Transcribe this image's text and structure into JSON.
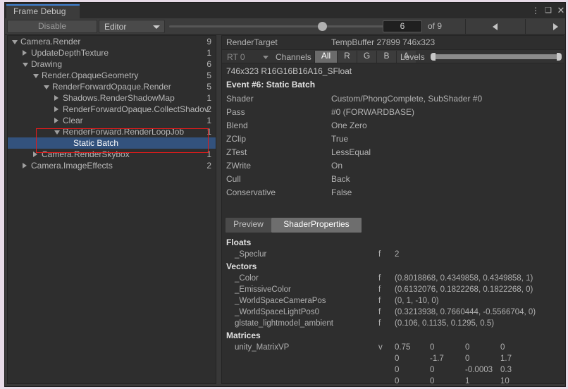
{
  "window": {
    "tab_label": "Frame Debug",
    "menu_icon": "⋮",
    "maximize_icon": "❑",
    "close_icon": "✕",
    "accent_color": "#3f80d0"
  },
  "toolbar": {
    "disable_label": "Disable",
    "target_dropdown": "Editor",
    "frame_value": "6",
    "frame_total_label": "of 9",
    "slider_percent": 63,
    "prev_icon": "triangle-left",
    "next_icon": "triangle-right"
  },
  "tree": {
    "rows": [
      {
        "label": "Camera.Render",
        "count": "9",
        "depth": 0,
        "twisty": "open",
        "selected": false
      },
      {
        "label": "UpdateDepthTexture",
        "count": "1",
        "depth": 1,
        "twisty": "closed",
        "selected": false
      },
      {
        "label": "Drawing",
        "count": "6",
        "depth": 1,
        "twisty": "open",
        "selected": false
      },
      {
        "label": "Render.OpaqueGeometry",
        "count": "5",
        "depth": 2,
        "twisty": "open",
        "selected": false
      },
      {
        "label": "RenderForwardOpaque.Render",
        "count": "5",
        "depth": 3,
        "twisty": "open",
        "selected": false
      },
      {
        "label": "Shadows.RenderShadowMap",
        "count": "1",
        "depth": 4,
        "twisty": "closed",
        "selected": false
      },
      {
        "label": "RenderForwardOpaque.CollectShadov",
        "count": "2",
        "depth": 4,
        "twisty": "closed",
        "selected": false
      },
      {
        "label": "Clear",
        "count": "1",
        "depth": 4,
        "twisty": "closed",
        "selected": false
      },
      {
        "label": "RenderForward.RenderLoopJob",
        "count": "1",
        "depth": 4,
        "twisty": "open",
        "selected": false
      },
      {
        "label": "Static Batch",
        "count": "",
        "depth": 5,
        "twisty": "none",
        "selected": true
      },
      {
        "label": "Camera.RenderSkybox",
        "count": "1",
        "depth": 2,
        "twisty": "closed",
        "selected": false
      },
      {
        "label": "Camera.ImageEffects",
        "count": "2",
        "depth": 1,
        "twisty": "closed",
        "selected": false
      }
    ],
    "highlight_color": "#e01b1b",
    "selection_color": "#33527d"
  },
  "detail": {
    "render_target_key": "RenderTarget",
    "render_target_value": "TempBuffer 27899 746x323",
    "rt_dropdown": "RT 0",
    "channels_label": "Channels",
    "channel_buttons": [
      "All",
      "R",
      "G",
      "B",
      "A"
    ],
    "channel_active": "All",
    "levels_label": "Levels",
    "format_line": "746x323 R16G16B16A16_SFloat",
    "event_line": "Event #6: Static Batch",
    "states": [
      {
        "key": "Shader",
        "value": "Custom/PhongComplete, SubShader #0"
      },
      {
        "key": "Pass",
        "value": "#0 (FORWARDBASE)"
      },
      {
        "key": "Blend",
        "value": "One Zero"
      },
      {
        "key": "ZClip",
        "value": "True"
      },
      {
        "key": "ZTest",
        "value": "LessEqual"
      },
      {
        "key": "ZWrite",
        "value": "On"
      },
      {
        "key": "Cull",
        "value": "Back"
      },
      {
        "key": "Conservative",
        "value": "False"
      }
    ]
  },
  "shader_properties": {
    "tabs": [
      {
        "label": "Preview",
        "active": false
      },
      {
        "label": "ShaderProperties",
        "active": true
      }
    ],
    "sections": [
      {
        "title": "Floats",
        "kind": "scalar",
        "rows": [
          {
            "name": "_Speclur",
            "type": "f",
            "value": "2"
          }
        ]
      },
      {
        "title": "Vectors",
        "kind": "scalar",
        "rows": [
          {
            "name": "_Color",
            "type": "f",
            "value": "(0.8018868, 0.4349858, 0.4349858, 1)"
          },
          {
            "name": "_EmissiveColor",
            "type": "f",
            "value": "(0.6132076, 0.1822268, 0.1822268, 0)"
          },
          {
            "name": "_WorldSpaceCameraPos",
            "type": "f",
            "value": "(0, 1, -10, 0)"
          },
          {
            "name": "_WorldSpaceLightPos0",
            "type": "f",
            "value": "(0.3213938, 0.7660444, -0.5566704, 0)"
          },
          {
            "name": "glstate_lightmodel_ambient",
            "type": "f",
            "value": "(0.106, 0.1135, 0.1295, 0.5)"
          }
        ]
      },
      {
        "title": "Matrices",
        "kind": "matrix",
        "rows": [
          {
            "name": "unity_MatrixVP",
            "type": "v",
            "matrix": [
              [
                "0.75",
                "0",
                "0",
                "0"
              ],
              [
                "0",
                "-1.7",
                "0",
                "1.7"
              ],
              [
                "0",
                "0",
                "-0.0003",
                "0.3"
              ],
              [
                "0",
                "0",
                "1",
                "10"
              ]
            ]
          }
        ]
      }
    ]
  }
}
